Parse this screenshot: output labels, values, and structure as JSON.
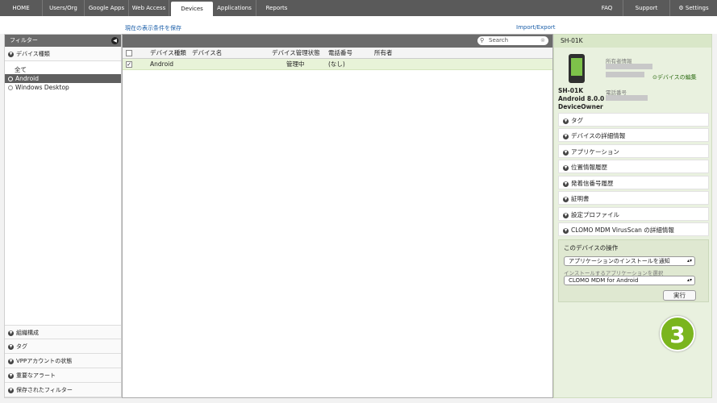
{
  "nav": {
    "tabs": [
      "HOME",
      "Users/Org",
      "Google Apps",
      "Web Access",
      "Devices",
      "Applications",
      "Reports"
    ],
    "right_items": [
      "FAQ",
      "Support",
      "Settings"
    ]
  },
  "subbar": {
    "save_view_link": "現在の表示条件を保存",
    "import_export_link": "Import/Export"
  },
  "sidebar": {
    "header": "フィルター",
    "section_device_type": "デバイス種類",
    "filters": [
      "全て",
      "Android",
      "Windows Desktop"
    ],
    "selected_filter": "Android",
    "bottom_sections": [
      "組織構成",
      "タグ",
      "VPPアカウントの状態",
      "重要なアラート",
      "保存されたフィルター"
    ]
  },
  "main": {
    "search_placeholder": "Search",
    "columns": [
      "デバイス種類",
      "デバイス名",
      "デバイス管理状態",
      "電話番号",
      "所有者"
    ],
    "rows": [
      {
        "device_type": "Android",
        "device_name": "",
        "management_state": "管理中",
        "phone": "(なし)",
        "owner": ""
      }
    ]
  },
  "detail": {
    "title": "SH-01K",
    "device_model": "SH-01K",
    "os_version": "Android 8.0.0",
    "ownership": "DeviceOwner",
    "owner_info_label": "所有者情報",
    "phone_label": "電話番号",
    "edit_link": "デバイスの編集",
    "accordion": [
      "タグ",
      "デバイスの詳細情報",
      "アプリケーション",
      "位置情報履歴",
      "発着信番号履歴",
      "証明書",
      "設定プロファイル",
      "CLOMO MDM VirusScan の詳細情報"
    ],
    "ops": {
      "title": "このデバイスの操作",
      "action_value": "アプリケーションのインストールを通知",
      "app_select_label": "インストールするアプリケーションを選択",
      "app_value": "CLOMO MDM for Android",
      "execute_label": "実行"
    }
  },
  "step_badge": "3",
  "colors": {
    "accent_green": "#7ab51d",
    "topbar": "#5a5a5a",
    "selected_row": "#e8f3d8"
  }
}
